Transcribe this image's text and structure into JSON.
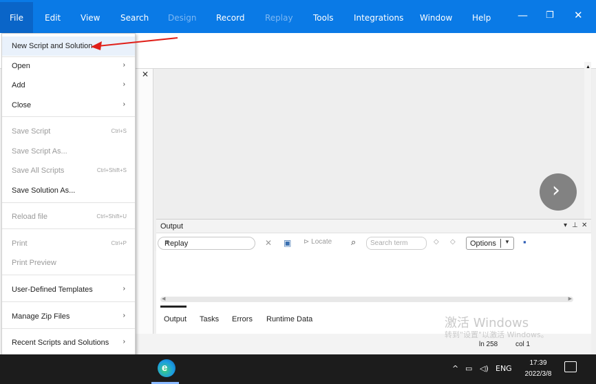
{
  "menubar": {
    "items": [
      {
        "label": "File",
        "state": "active"
      },
      {
        "label": "Edit",
        "state": "enabled"
      },
      {
        "label": "View",
        "state": "enabled"
      },
      {
        "label": "Search",
        "state": "enabled"
      },
      {
        "label": "Design",
        "state": "disabled"
      },
      {
        "label": "Record",
        "state": "enabled"
      },
      {
        "label": "Replay",
        "state": "disabled"
      },
      {
        "label": "Tools",
        "state": "enabled"
      },
      {
        "label": "Integrations",
        "state": "enabled"
      },
      {
        "label": "Window",
        "state": "enabled"
      },
      {
        "label": "Help",
        "state": "enabled"
      }
    ],
    "window_controls": {
      "minimize": "—",
      "restore": "❐",
      "close": "✕"
    },
    "color": "#0a7ae6"
  },
  "file_menu": {
    "items": [
      {
        "label": "New Script and Solution",
        "shortcut": "",
        "submenu": false,
        "disabled": false,
        "hover": true
      },
      {
        "label": "Open",
        "shortcut": "",
        "submenu": true,
        "disabled": false
      },
      {
        "label": "Add",
        "shortcut": "",
        "submenu": true,
        "disabled": false
      },
      {
        "label": "Close",
        "shortcut": "",
        "submenu": true,
        "disabled": false
      },
      {
        "label": "Save Script",
        "shortcut": "Ctrl+S",
        "submenu": false,
        "disabled": true
      },
      {
        "label": "Save Script As...",
        "shortcut": "",
        "submenu": false,
        "disabled": true
      },
      {
        "label": "Save All Scripts",
        "shortcut": "Ctrl+Shift+S",
        "submenu": false,
        "disabled": true
      },
      {
        "label": "Save Solution As...",
        "shortcut": "",
        "submenu": false,
        "disabled": false
      },
      {
        "label": "Reload file",
        "shortcut": "Ctrl+Shift+U",
        "submenu": false,
        "disabled": true
      },
      {
        "label": "Print",
        "shortcut": "Ctrl+P",
        "submenu": false,
        "disabled": true
      },
      {
        "label": "Print Preview",
        "shortcut": "",
        "submenu": false,
        "disabled": true
      },
      {
        "label": "User-Defined Templates",
        "shortcut": "",
        "submenu": true,
        "disabled": false
      },
      {
        "label": "Manage Zip Files",
        "shortcut": "",
        "submenu": true,
        "disabled": false
      },
      {
        "label": "Recent Scripts and Solutions",
        "shortcut": "",
        "submenu": true,
        "disabled": false
      }
    ]
  },
  "output": {
    "title": "Output",
    "controls": {
      "dropdown": "▾",
      "pin": "⊥",
      "close": "✕"
    },
    "source_select": "Replay",
    "locate_label": "Locate",
    "search_placeholder": "Search term",
    "options_label": "Options",
    "tabs": [
      "Output",
      "Tasks",
      "Errors",
      "Runtime Data"
    ]
  },
  "status": {
    "line": "ln 258",
    "col": "col 1"
  },
  "activation": {
    "title": "激活 Windows",
    "subtitle": "转到\"设置\"以激活 Windows。"
  },
  "taskbar": {
    "tray_lang": "ENG",
    "time": "17:39",
    "date": "2022/3/8"
  },
  "overlay": {
    "next_glyph": "›"
  }
}
